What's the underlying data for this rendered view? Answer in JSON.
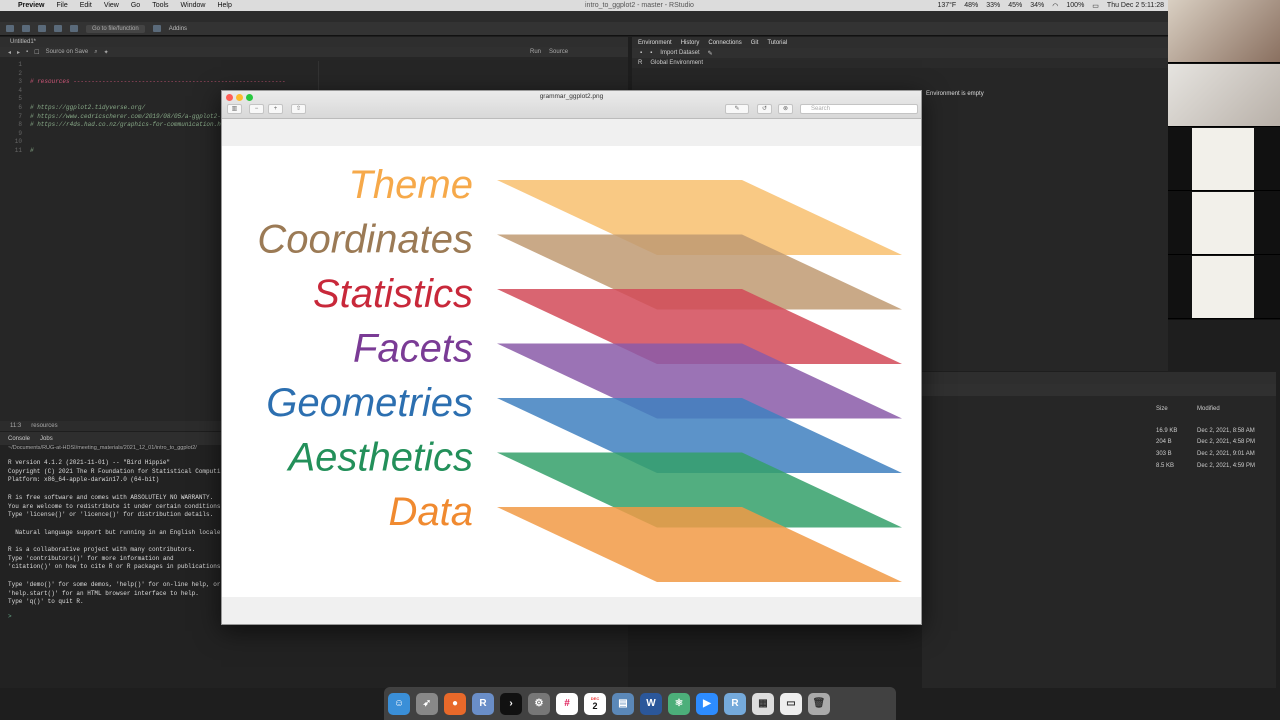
{
  "menubar": {
    "app": "Preview",
    "items": [
      "File",
      "Edit",
      "View",
      "Go",
      "Tools",
      "Window",
      "Help"
    ],
    "window_title": "intro_to_ggplot2 - master - RStudio",
    "status": [
      "137°F",
      "48%",
      "33%",
      "45%",
      "34%",
      "100%"
    ],
    "clock": "Thu Dec 2  5:11:28"
  },
  "rstudio": {
    "toolbar": {
      "goto_placeholder": "Go to file/function",
      "addins": "Addins"
    },
    "editor": {
      "tab": "Untitled1*",
      "source_on_save": "Source on Save",
      "run": "Run",
      "source": "Source",
      "line_numbers": [
        "1",
        "2",
        "3",
        "4",
        "5",
        "6",
        "7",
        "8",
        "9",
        "10",
        "11"
      ],
      "code": [
        "",
        "",
        "# resources -----------------------------------------------------------",
        "",
        "",
        "# https://ggplot2.tidyverse.org/",
        "# https://www.cedricscherer.com/2019/08/05/a-ggplot2-",
        "# https://r4ds.had.co.nz/graphics-for-communication.h",
        "",
        "",
        "#"
      ],
      "status_pos": "11:3",
      "status_section": "resources"
    },
    "console": {
      "tabs": [
        "Console",
        "Jobs"
      ],
      "path": "~/Documents/RUG-at-HDSI/meeting_materials/2021_12_01/intro_to_ggplot2/",
      "lines": [
        "R version 4.1.2 (2021-11-01) -- \"Bird Hippie\"",
        "Copyright (C) 2021 The R Foundation for Statistical Computi",
        "Platform: x86_64-apple-darwin17.0 (64-bit)",
        "",
        "R is free software and comes with ABSOLUTELY NO WARRANTY.",
        "You are welcome to redistribute it under certain conditions",
        "Type 'license()' or 'licence()' for distribution details.",
        "",
        "  Natural language support but running in an English locale",
        "",
        "R is a collaborative project with many contributors.",
        "Type 'contributors()' for more information and",
        "'citation()' on how to cite R or R packages in publications",
        "",
        "Type 'demo()' for some demos, 'help()' for on-line help, or",
        "'help.start()' for an HTML browser interface to help.",
        "Type 'q()' to quit R."
      ],
      "prompt": ">"
    },
    "env": {
      "tabs": [
        "Environment",
        "History",
        "Connections",
        "Git",
        "Tutorial"
      ],
      "import": "Import Dataset",
      "scope": "Global Environment",
      "r_label": "R",
      "empty": "Environment is empty"
    },
    "files": {
      "headers": {
        "size": "Size",
        "modified": "Modified"
      },
      "rows": [
        {
          "size": "16.9 KB",
          "modified": "Dec 2, 2021, 8:58 AM"
        },
        {
          "size": "204 B",
          "modified": "Dec 2, 2021, 4:58 PM"
        },
        {
          "size": "303 B",
          "modified": "Dec 2, 2021, 9:01 AM"
        },
        {
          "size": "8.5 KB",
          "modified": "Dec 2, 2021, 4:59 PM"
        }
      ]
    }
  },
  "preview": {
    "title": "grammar_ggplot2.png",
    "search_placeholder": "Search",
    "layers": [
      {
        "label": "Theme",
        "color": "#f6a94a",
        "fill": "#f8c06e"
      },
      {
        "label": "Coordinates",
        "color": "#9b7a55",
        "fill": "#c09a72"
      },
      {
        "label": "Statistics",
        "color": "#c8283a",
        "fill": "#d24a58"
      },
      {
        "label": "Facets",
        "color": "#7a3b95",
        "fill": "#8a5aa8"
      },
      {
        "label": "Geometries",
        "color": "#2c6fb0",
        "fill": "#3f80c0"
      },
      {
        "label": "Aesthetics",
        "color": "#23905a",
        "fill": "#34a06a"
      },
      {
        "label": "Data",
        "color": "#f08a30",
        "fill": "#f19a45"
      }
    ]
  },
  "dock": {
    "icons": [
      "finder-icon",
      "launchpad-icon",
      "firefox-icon",
      "r-icon",
      "terminal-icon",
      "settings-icon",
      "slack-icon",
      "calendar-icon",
      "preview-icon",
      "word-icon",
      "atom-icon",
      "zoom-icon",
      "rstudio-icon",
      "downloads-icon",
      "document-icon",
      "trash-icon"
    ],
    "calendar_day": "2",
    "calendar_month": "DEC"
  },
  "colors": {
    "accent": "#4a90d9",
    "close": "#ff5f57",
    "min": "#febc2e",
    "max": "#28c840"
  }
}
